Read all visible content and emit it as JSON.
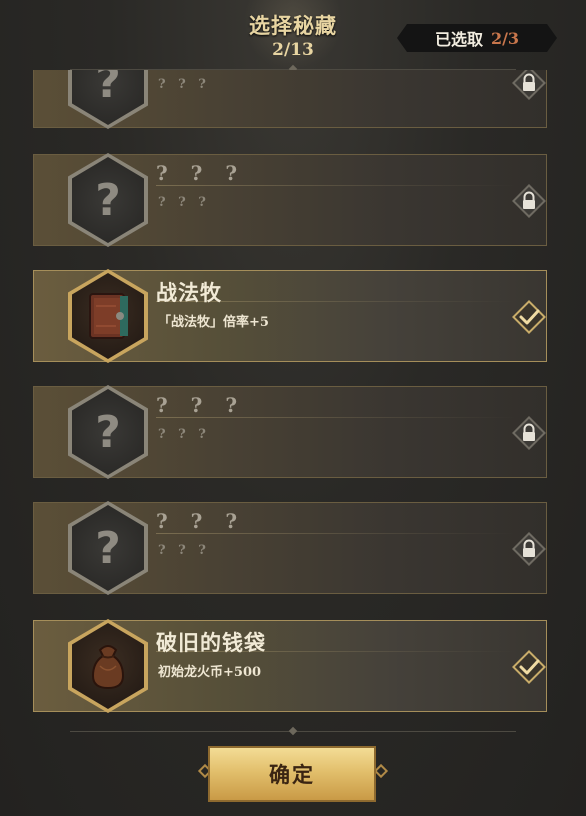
{
  "header": {
    "title": "选择秘藏",
    "count": "2/13",
    "selected_label": "已选取",
    "selected_value": "2/3"
  },
  "cards": [
    {
      "name": "? ? ?",
      "desc": "? ? ?",
      "state": "locked",
      "icon": "question-icon"
    },
    {
      "name": "? ? ?",
      "desc": "? ? ?",
      "state": "locked",
      "icon": "question-icon"
    },
    {
      "name": "战法牧",
      "desc": "「战法牧」倍率+5",
      "state": "selected",
      "icon": "tome-icon"
    },
    {
      "name": "? ? ?",
      "desc": "? ? ?",
      "state": "locked",
      "icon": "question-icon"
    },
    {
      "name": "? ? ?",
      "desc": "? ? ?",
      "state": "locked",
      "icon": "question-icon"
    },
    {
      "name": "破旧的钱袋",
      "desc": "初始龙火币+500",
      "state": "selected",
      "icon": "coin-pouch-icon"
    }
  ],
  "confirm_label": "确定",
  "colors": {
    "accent_gold": "#c9ad6a",
    "button_gold": "#e2bf6c",
    "selected_value": "#c8764c"
  }
}
